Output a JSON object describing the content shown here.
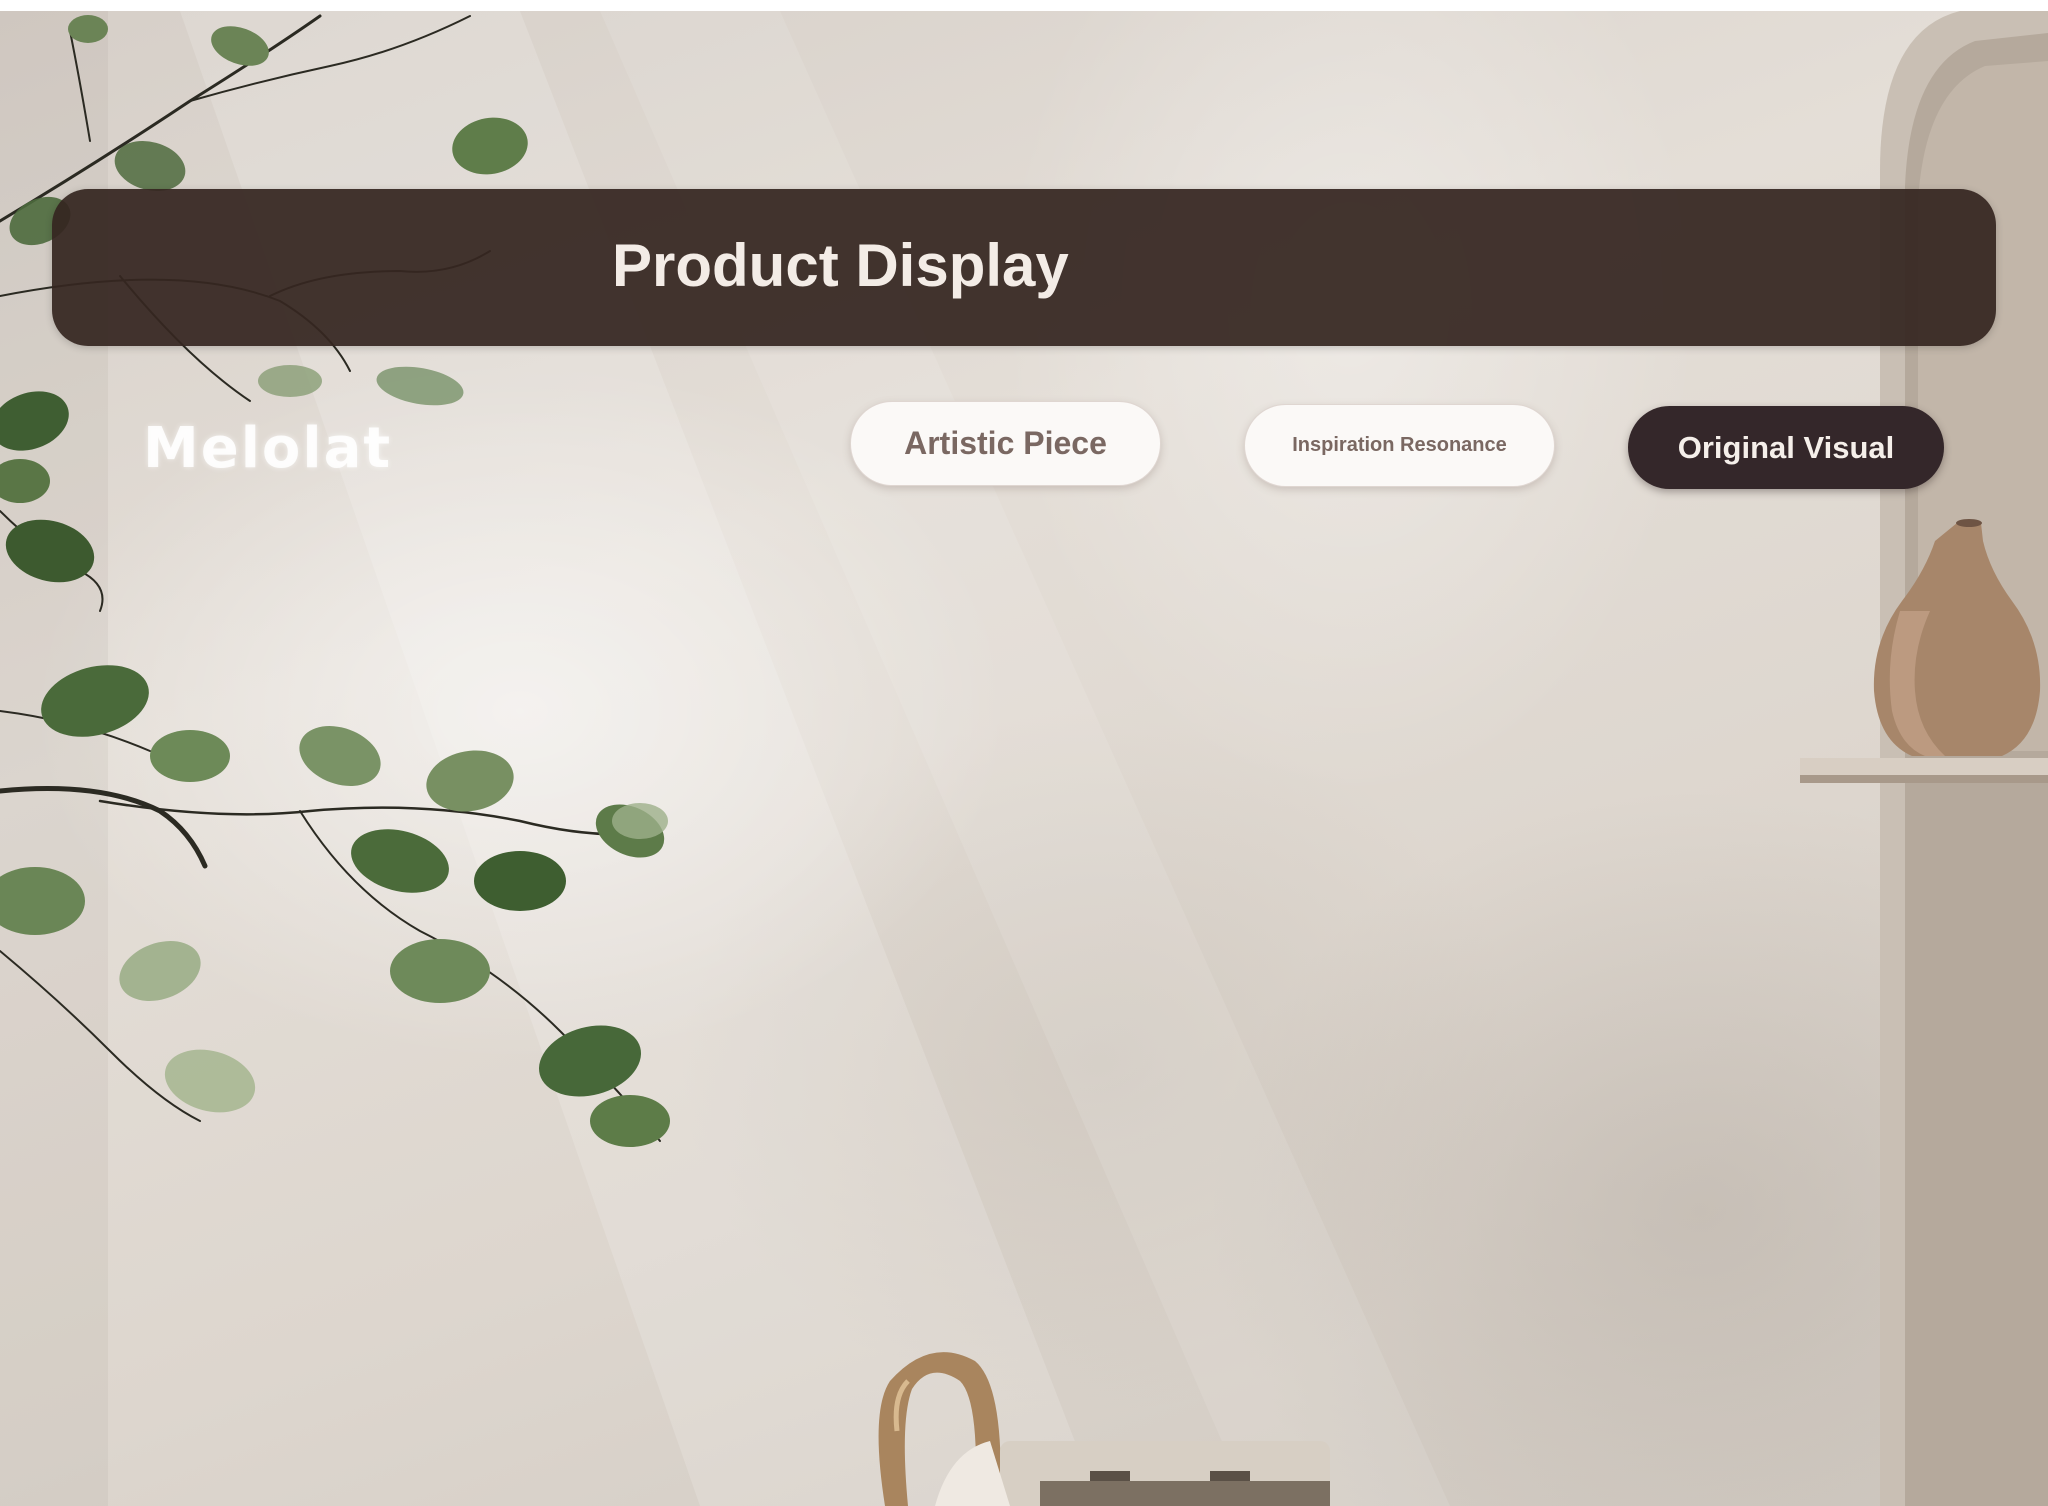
{
  "header": {
    "title": "Product Display"
  },
  "brand": {
    "logo_text": "Melolat"
  },
  "nav": {
    "buttons": [
      {
        "label": "Artistic Piece",
        "style": "light"
      },
      {
        "label": "Inspiration Resonance",
        "style": "light"
      },
      {
        "label": "Original Visual",
        "style": "dark"
      }
    ]
  },
  "colors": {
    "header_bar": "#352620",
    "title_text": "#f3ece6",
    "light_pill_bg": "#fbf9f7",
    "light_pill_text": "#7a6862",
    "dark_pill_bg": "#34272a",
    "dark_pill_text": "#f5efea",
    "wall": "#ddd6ce"
  },
  "background": {
    "icons": [
      "fig-branch-icon",
      "ceramic-vase-icon",
      "wall-niche-icon",
      "ring-handle-bag-icon"
    ]
  }
}
